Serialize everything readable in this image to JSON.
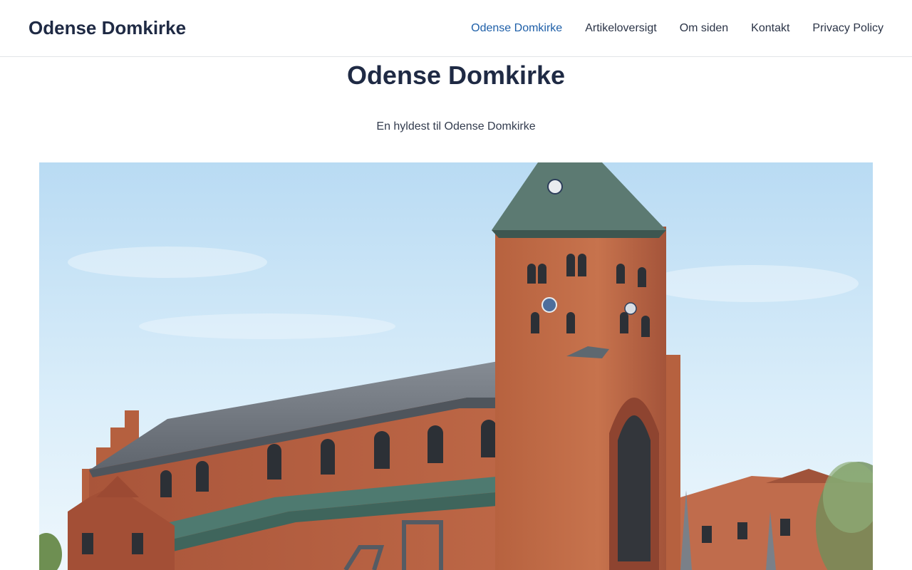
{
  "site": {
    "title": "Odense Domkirke"
  },
  "nav": {
    "items": [
      {
        "label": "Odense Domkirke",
        "active": true
      },
      {
        "label": "Artikeloversigt",
        "active": false
      },
      {
        "label": "Om siden",
        "active": false
      },
      {
        "label": "Kontakt",
        "active": false
      },
      {
        "label": "Privacy Policy",
        "active": false
      }
    ]
  },
  "page": {
    "title": "Odense Domkirke",
    "subtitle": "En hyldest til Odense Domkirke"
  },
  "colors": {
    "text": "#1f2a44",
    "active_link": "#1e5fa8",
    "brick": "#b45a3c",
    "roof_slate": "#6d737c",
    "copper_roof": "#4e7a70",
    "sky": "#cfe6f6"
  }
}
